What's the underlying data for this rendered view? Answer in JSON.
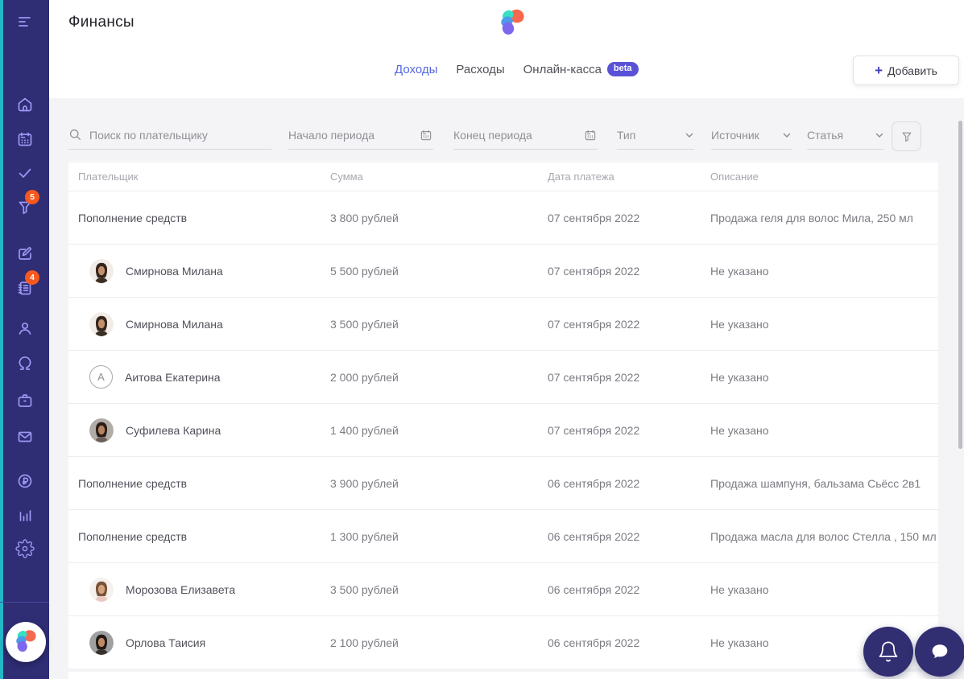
{
  "app": {
    "title": "Финансы"
  },
  "colors": {
    "sidebar_bg": "#2f2d74",
    "accent_stripe": "#24b7c8",
    "sidebar_icon": "#9d98f4",
    "badge": "#f7581e",
    "active_tab": "#5569e1",
    "beta_badge_bg": "#5a52d6",
    "page_bg": "#f4f4f6",
    "logo_coral": "#f5684f",
    "logo_mint": "#35e0c2",
    "logo_blue": "#4b9bea",
    "logo_purple": "#7b68ee"
  },
  "sidebar": {
    "filter_badge": "5",
    "journal_badge": "4"
  },
  "tabs": [
    {
      "label": "Доходы",
      "active": true
    },
    {
      "label": "Расходы",
      "active": false
    },
    {
      "label": "Онлайн-касса",
      "active": false,
      "badge": "beta"
    }
  ],
  "add_button": {
    "plus": "+",
    "label": "Добавить"
  },
  "filters": {
    "search_placeholder": "Поиск по плательщику",
    "period_start": "Начало периода",
    "period_end": "Конец периода",
    "type": "Тип",
    "source": "Источник",
    "article": "Статья"
  },
  "table": {
    "columns": [
      "Плательщик",
      "Сумма",
      "Дата платежа",
      "Описание"
    ],
    "rows": [
      {
        "payer": "Пополнение средств",
        "amount": "3 800 рублей",
        "date": "07 сентября 2022",
        "description": "Продажа геля для волос Мила, 250 мл",
        "avatar": {
          "kind": "none"
        }
      },
      {
        "payer": "Смирнова Милана",
        "amount": "5 500 рублей",
        "date": "07 сентября 2022",
        "description": "Не указано",
        "avatar": {
          "kind": "photo",
          "bg": "#f1ece7",
          "hair": "#33241b",
          "skin": "#c2916c",
          "shirt": "#3a2d24"
        }
      },
      {
        "payer": "Смирнова Милана",
        "amount": "3 500 рублей",
        "date": "07 сентября 2022",
        "description": "Не указано",
        "avatar": {
          "kind": "photo",
          "bg": "#f1ece7",
          "hair": "#33241b",
          "skin": "#c2916c",
          "shirt": "#3a2d24"
        }
      },
      {
        "payer": "Аитова Екатерина",
        "amount": "2 000 рублей",
        "date": "07 сентября 2022",
        "description": "Не указано",
        "avatar": {
          "kind": "initial",
          "initial": "А"
        }
      },
      {
        "payer": "Суфилева Карина",
        "amount": "1 400 рублей",
        "date": "07 сентября 2022",
        "description": "Не указано",
        "avatar": {
          "kind": "photo",
          "bg": "#b3aca6",
          "hair": "#2a1d18",
          "skin": "#b5835f",
          "shirt": "#6b5f57"
        }
      },
      {
        "payer": "Пополнение средств",
        "amount": "3 900 рублей",
        "date": "06 сентября 2022",
        "description": "Продажа шампуня, бальзама Сьёсс 2в1",
        "avatar": {
          "kind": "none"
        }
      },
      {
        "payer": "Пополнение средств",
        "amount": "1 300 рублей",
        "date": "06 сентября 2022",
        "description": "Продажа масла для волос Стелла , 150 мл",
        "avatar": {
          "kind": "none"
        }
      },
      {
        "payer": "Морозова Елизавета",
        "amount": "3 500 рублей",
        "date": "06 сентября 2022",
        "description": "Не указано",
        "avatar": {
          "kind": "photo",
          "bg": "#f4f1ee",
          "hair": "#7a5336",
          "skin": "#d3a384",
          "shirt": "#e8c8c0"
        }
      },
      {
        "payer": "Орлова Таисия",
        "amount": "2 100 рублей",
        "date": "06 сентября 2022",
        "description": "Не указано",
        "avatar": {
          "kind": "photo",
          "bg": "#a0a0a2",
          "hair": "#221914",
          "skin": "#c08a67",
          "shirt": "#35302c"
        }
      }
    ]
  }
}
